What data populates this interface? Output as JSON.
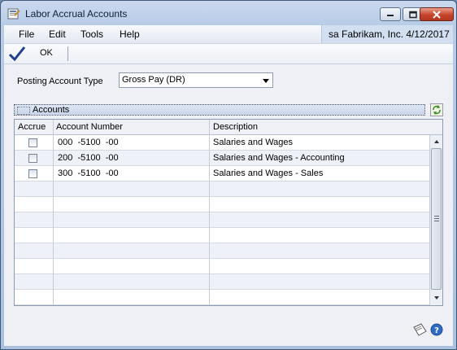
{
  "window": {
    "title": "Labor Accrual Accounts"
  },
  "menu": {
    "items": [
      "File",
      "Edit",
      "Tools",
      "Help"
    ]
  },
  "user_info": "sa  Fabrikam, Inc.  4/12/2017",
  "toolbar": {
    "ok_label": "OK"
  },
  "posting": {
    "label": "Posting Account Type",
    "value": "Gross Pay (DR)"
  },
  "accounts": {
    "header": "Accounts"
  },
  "grid": {
    "columns": [
      "Accrue",
      "Account Number",
      "Description"
    ],
    "rows": [
      {
        "accrue": false,
        "account": "000  -5100  -00",
        "description": "Salaries and Wages"
      },
      {
        "accrue": false,
        "account": "200  -5100  -00",
        "description": "Salaries and Wages - Accounting"
      },
      {
        "accrue": false,
        "account": "300  -5100  -00",
        "description": "Salaries and Wages - Sales"
      }
    ]
  },
  "icons": [
    "app-icon",
    "minimize-icon",
    "maximize-icon",
    "close-icon",
    "checkmark-icon",
    "dropdown-arrow-icon",
    "refresh-icon",
    "scroll-up-icon",
    "scroll-down-icon",
    "note-icon",
    "help-icon"
  ],
  "colors": {
    "accent": "#1f3f8f",
    "close": "#c7432a",
    "alt_row": "#eef1f8"
  }
}
